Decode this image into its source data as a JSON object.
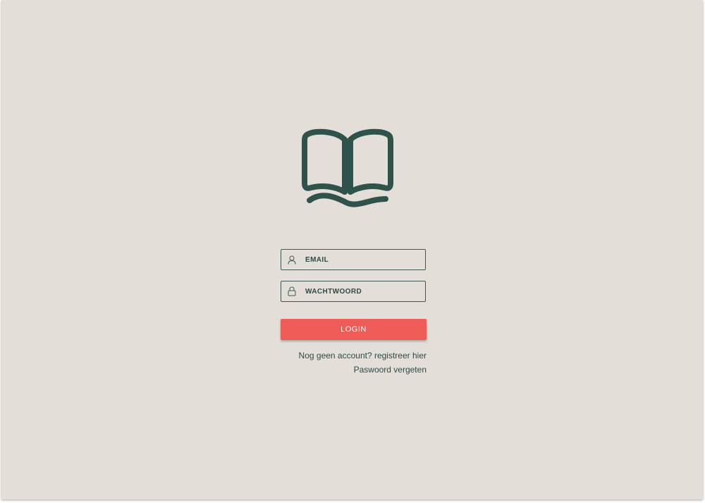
{
  "logo": {
    "icon": "open-book-icon",
    "color": "#2f534b"
  },
  "form": {
    "email_placeholder": "EMAIL",
    "email_icon": "user-icon",
    "password_placeholder": "WACHTWOORD",
    "password_icon": "lock-icon",
    "login_label": "LOGIN"
  },
  "links": {
    "register": "Nog geen account? registreer hier",
    "forgot": "Paswoord vergeten"
  },
  "colors": {
    "background": "#e3dfd8",
    "accent": "#ef5b57",
    "text": "#2f4a44"
  }
}
